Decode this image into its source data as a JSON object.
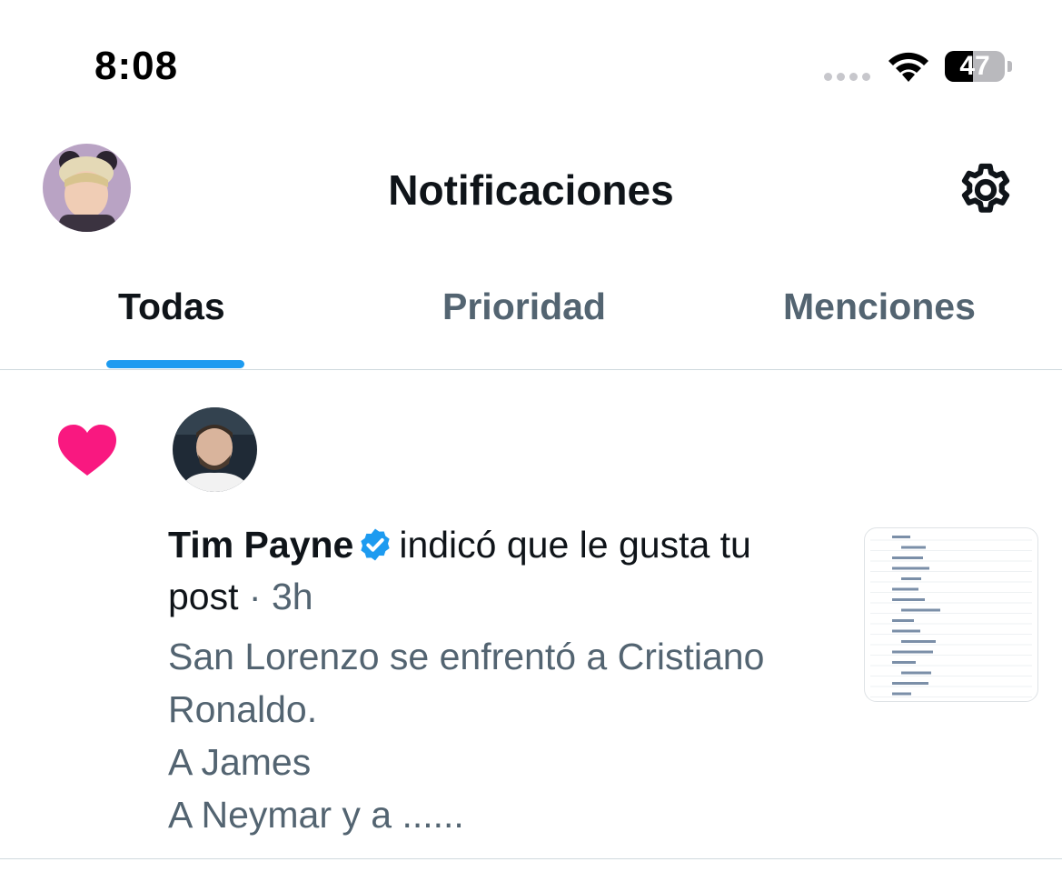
{
  "status_bar": {
    "time": "8:08",
    "battery_level": "47",
    "icons": [
      "cellular-signal-icon",
      "wifi-icon",
      "battery-icon"
    ]
  },
  "header": {
    "title": "Notificaciones",
    "avatar_icon": "profile-avatar",
    "settings_icon": "gear-icon"
  },
  "tabs": [
    {
      "label": "Todas",
      "active": true
    },
    {
      "label": "Prioridad",
      "active": false
    },
    {
      "label": "Menciones",
      "active": false
    }
  ],
  "colors": {
    "accent": "#1d9bf0",
    "like": "#f91880",
    "text_primary": "#0f1419",
    "text_secondary": "#536471",
    "divider": "#cfd9de"
  },
  "notification": {
    "type_icon": "heart-icon",
    "user_name": "Tim Payne",
    "verified_icon": "verified-badge-icon",
    "action": "indicó que le gusta tu",
    "action_tail": "post",
    "separator": "·",
    "time_ago": "3h",
    "excerpt": "San Lorenzo se enfrentó a Cristiano\nRonaldo.\nA James\nA Neymar y a ......"
  }
}
